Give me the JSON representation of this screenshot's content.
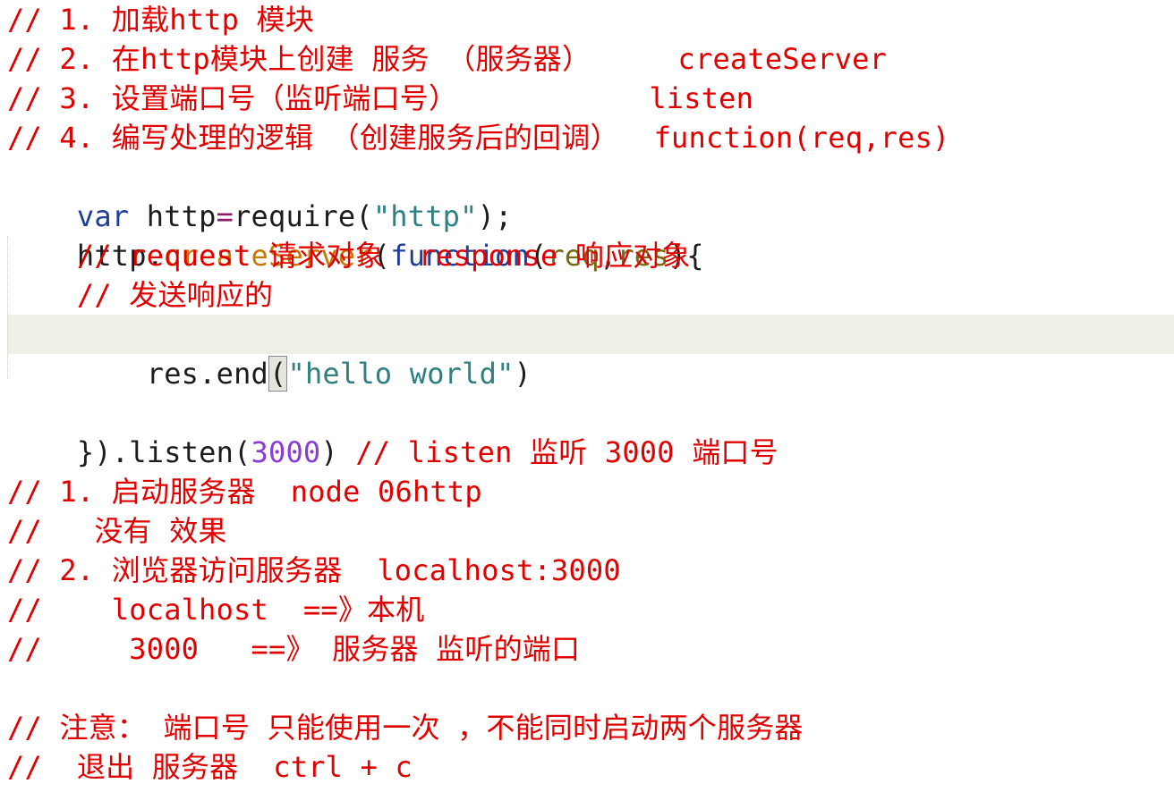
{
  "code_lines": [
    "// 1. 加载http 模块",
    "// 2. 在http模块上创建 服务 （服务器）     createServer",
    "// 3. 设置端口号（监听端口号）           listen",
    "// 4. 编写处理的逻辑 （创建服务后的回调）  function(req,res)",
    "var http=require(\"http\");",
    "http.createServer(function(req,res){",
    "    // request 请求对象  response 响应对象",
    "    // 发送响应的",
    "    res.end(\"hello world\")",
    "",
    "}).listen(3000) // listen 监听 3000 端口号",
    "",
    "// 1. 启动服务器  node 06http",
    "//   没有 效果",
    "// 2. 浏览器访问服务器  localhost:3000",
    "//    localhost  ==》本机",
    "//     3000   ==》 服务器 监听的端口",
    "",
    "// 注意： 端口号 只能使用一次 ，不能同时启动两个服务器",
    "//  退出 服务器  ctrl + c"
  ],
  "tokens": {
    "l5": {
      "kw": "var",
      "ident": " http",
      "eq": "=",
      "call": "require(",
      "str": "\"http\"",
      "end": ");"
    },
    "l6": {
      "obj": "http.",
      "fn": "createServer",
      "p1": "(",
      "kw": "function",
      "p2": "(",
      "a1": "req",
      "comma": ",",
      "a2": "res",
      "p3": "){"
    },
    "l9": {
      "indent": "    ",
      "call": "res.end",
      "lp": "(",
      "str": "\"hello world\"",
      "rp": ")"
    },
    "l11": {
      "head": "}).listen(",
      "num": "3000",
      "rp": ")",
      "comment": " // listen 监听 3000 端口号"
    }
  },
  "colors": {
    "comment": "#e00000",
    "keyword": "#1f3d99",
    "string": "#2f8080",
    "function": "#c87800",
    "number": "#8a3bd6",
    "current_line": "#efefe6"
  }
}
